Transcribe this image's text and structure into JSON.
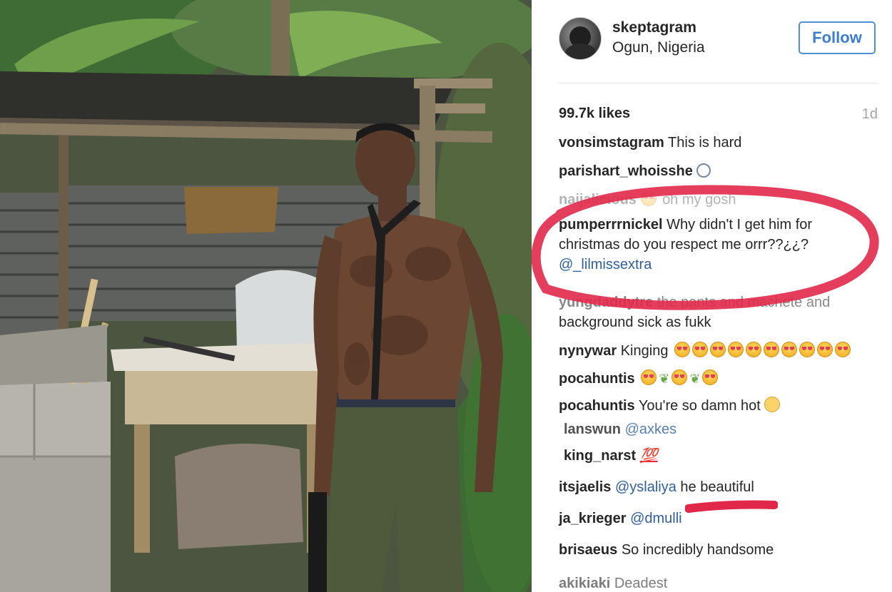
{
  "post": {
    "username": "skeptagram",
    "location": "Ogun, Nigeria",
    "follow_label": "Follow",
    "likes": "99.7k likes",
    "age": "1d"
  },
  "comments": [
    {
      "user": "vonsimstagram",
      "text": "This is hard"
    },
    {
      "user": "parishart_whoisshe",
      "text": "",
      "emoji": "ring-icon"
    },
    {
      "user": "naijalicious",
      "text": "oh my gosh",
      "emoji": "heart-eyes-icon"
    },
    {
      "user": "pumperrrnickel",
      "text": "Why didn't I get him for",
      "text2": "christmas do you respect me orrr??¿¿?",
      "mention": "@_lilmissextra"
    },
    {
      "user": "yungdaddytre",
      "text": "the pants and machete and",
      "text2": "background sick as fukk"
    },
    {
      "user": "nynywar",
      "text": "Kinging",
      "emoji": "heart-eyes-icon"
    },
    {
      "user": "pocahuntis",
      "text": "",
      "emoji": "heart-eyes-leaf-icon"
    },
    {
      "user": "pocahuntis",
      "text": "You're so damn hot",
      "emoji": "flushed-icon"
    },
    {
      "user": "lanswun",
      "text": "",
      "mention": "@axkes"
    },
    {
      "user": "king_narst",
      "text": "",
      "emoji": "hundred-icon"
    },
    {
      "user": "itsjaelis",
      "mention": "@yslaliya",
      "text": "he beautiful"
    },
    {
      "user": "ja_krieger",
      "mention": "@dmulli",
      "text": ""
    },
    {
      "user": "brisaeus",
      "text": "So incredibly handsome"
    },
    {
      "user": "akikiaki",
      "text": "Deadest"
    }
  ],
  "highlight": {
    "circle_color": "#e2284a",
    "underline_color": "#e2284a"
  },
  "colors": {
    "follow_border": "#4f90d4",
    "mention": "#2f5f9c",
    "muted": "#a6a6a6"
  }
}
